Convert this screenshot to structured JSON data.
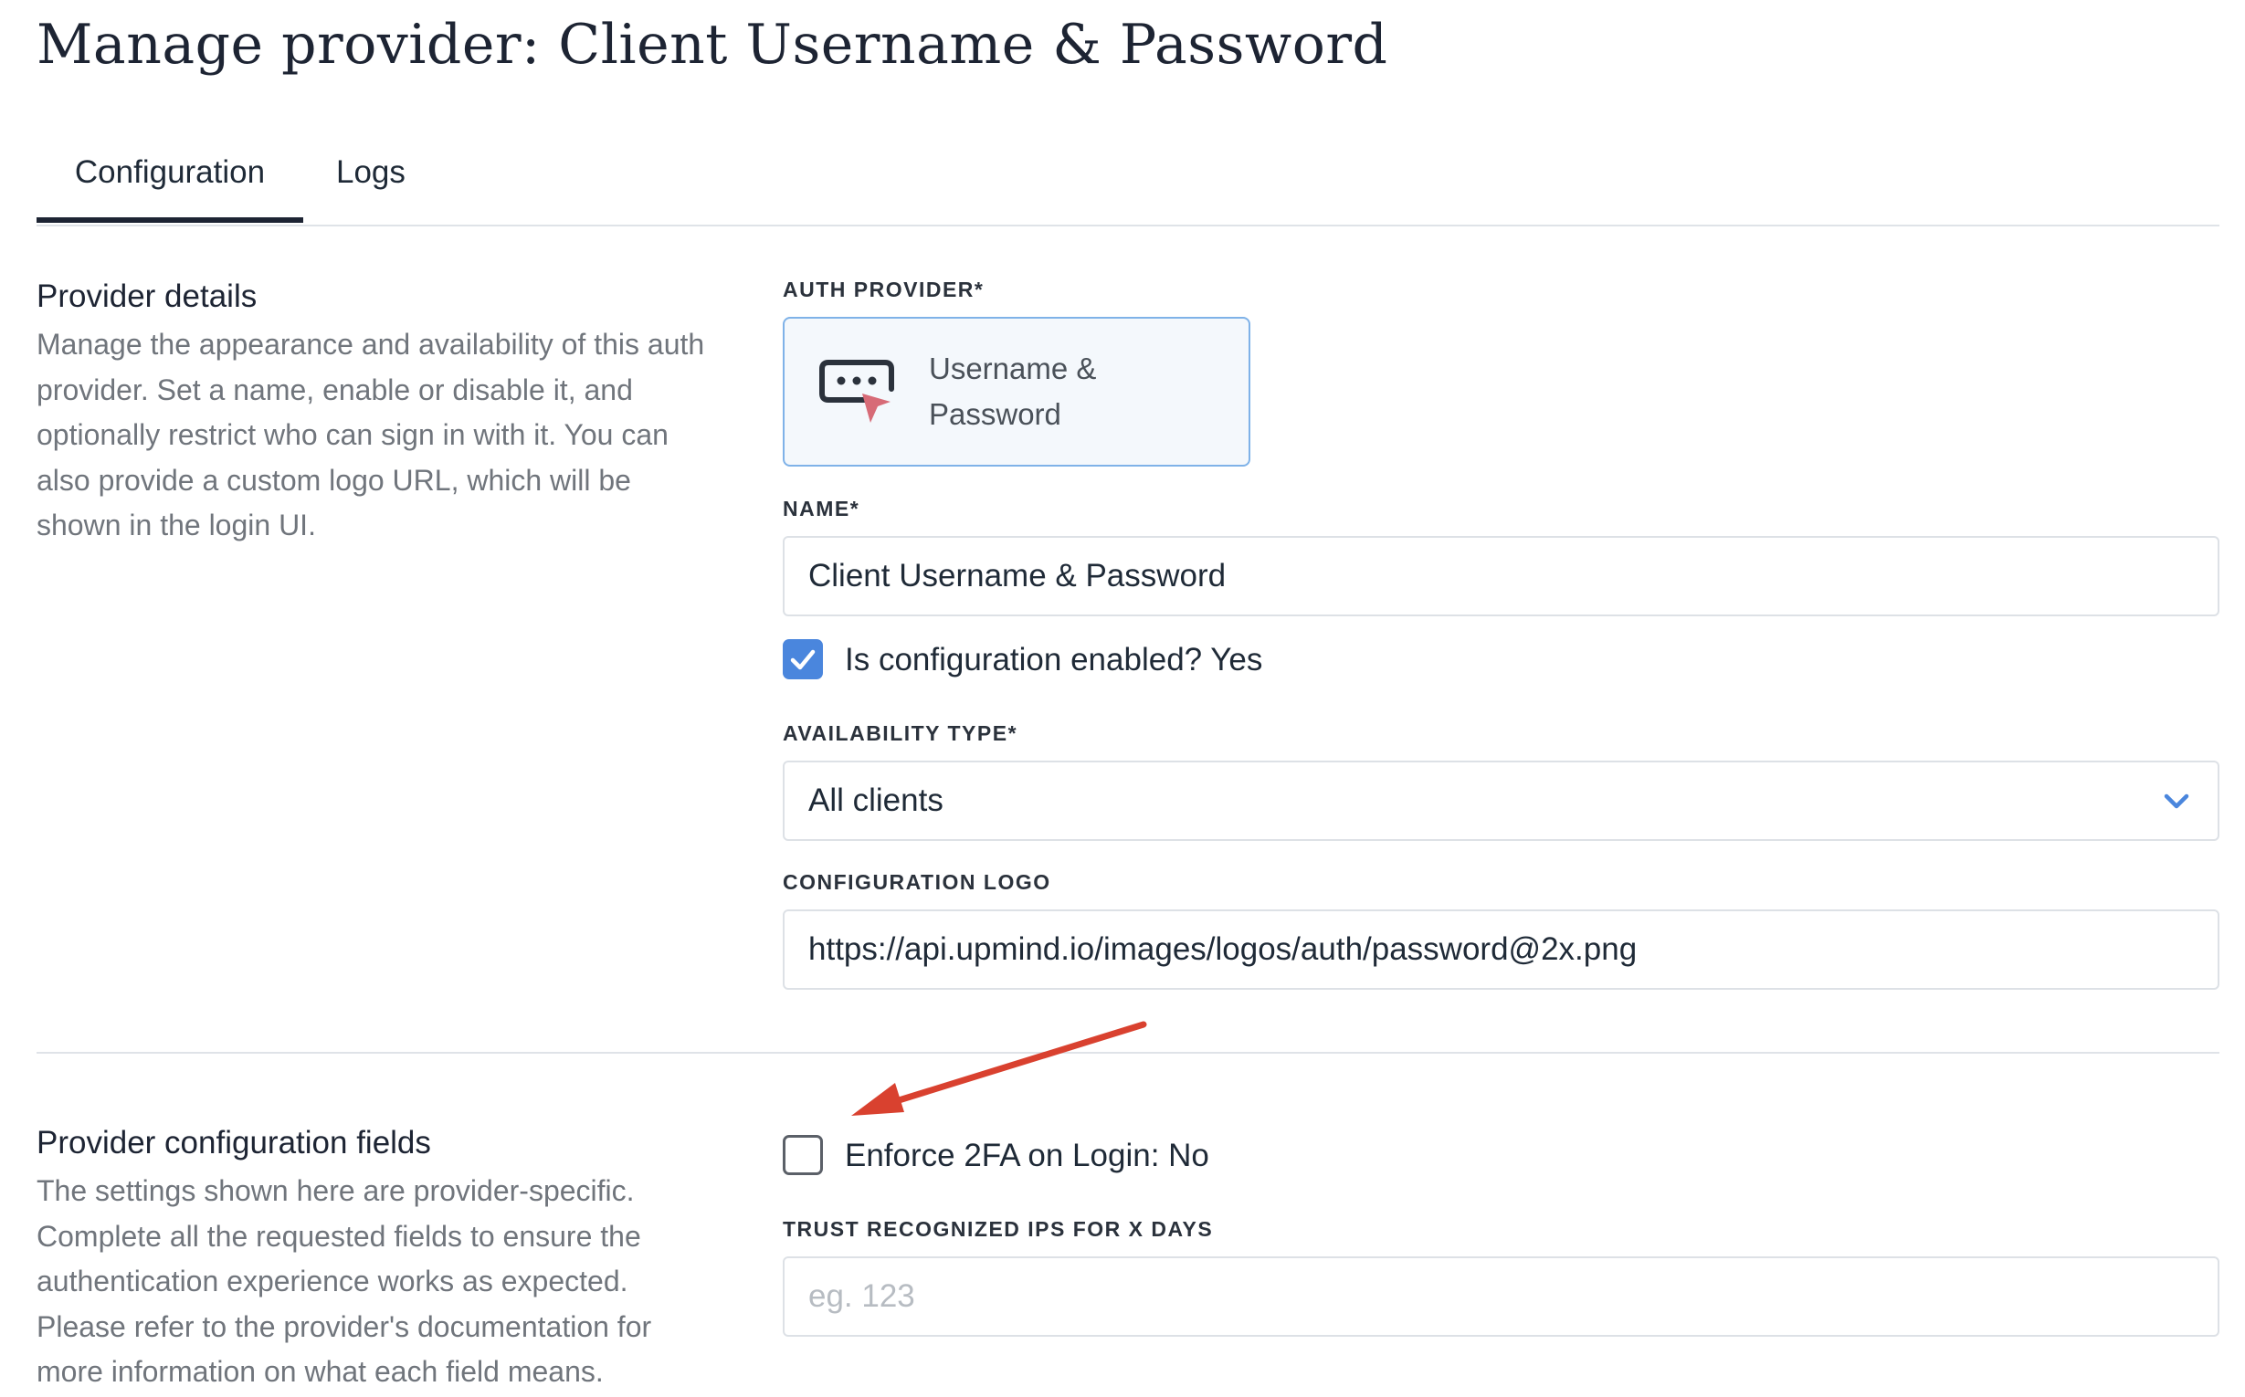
{
  "page": {
    "title": "Manage provider: Client Username & Password"
  },
  "tabs": [
    {
      "label": "Configuration"
    },
    {
      "label": "Logs"
    }
  ],
  "provider_details": {
    "title": "Provider details",
    "description": "Manage the appearance and availability of this auth provider. Set a name, enable or disable it, and optionally restrict who can sign in with it. You can also provide a custom logo URL, which will be shown in the login UI."
  },
  "auth_provider": {
    "label": "AUTH PROVIDER*",
    "card_label": "Username & Password",
    "icon": "password-cursor-icon"
  },
  "name_field": {
    "label": "NAME*",
    "value": "Client Username & Password"
  },
  "enabled": {
    "label": "Is configuration enabled?",
    "value": "Yes",
    "checked": true
  },
  "availability": {
    "label": "AVAILABILITY TYPE*",
    "value": "All clients",
    "icon": "chevron-down-icon"
  },
  "logo_field": {
    "label": "CONFIGURATION LOGO",
    "value": "https://api.upmind.io/images/logos/auth/password@2x.png"
  },
  "provider_config": {
    "title": "Provider configuration fields",
    "description": "The settings shown here are provider-specific. Complete all the requested fields to ensure the authentication experience works as expected. Please refer to the provider's documentation for more information on what each field means."
  },
  "enforce_2fa": {
    "label": "Enforce 2FA on Login:",
    "value": "No",
    "checked": false
  },
  "trust_ips": {
    "label": "TRUST RECOGNIZED IPS FOR X DAYS",
    "placeholder": "eg. 123"
  },
  "colors": {
    "accent": "#4a86dd",
    "card_border": "#7fb2e8",
    "annotation_arrow": "#d9412f"
  }
}
